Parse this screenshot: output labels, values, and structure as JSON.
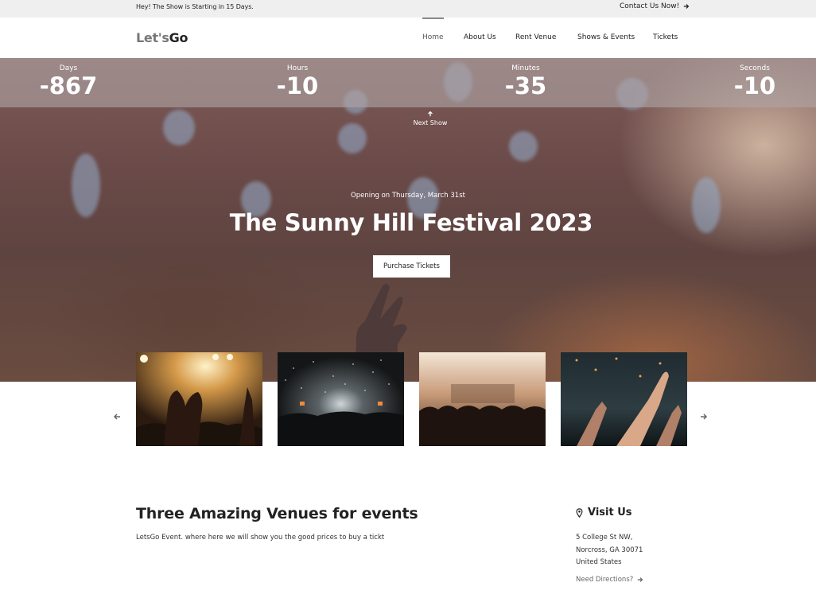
{
  "topbar": {
    "message": "Hey! The Show is Starting in 15 Days.",
    "contact_label": "Contact Us Now!"
  },
  "brand": {
    "logo_part1": "Let's",
    "logo_part2": "Go"
  },
  "nav": {
    "items": [
      {
        "label": "Home",
        "active": true
      },
      {
        "label": "About Us"
      },
      {
        "label": "Rent Venue"
      },
      {
        "label": "Shows & Events"
      },
      {
        "label": "Tickets"
      }
    ]
  },
  "countdown": {
    "days_label": "Days",
    "days_value": "-867",
    "hours_label": "Hours",
    "hours_value": "-10",
    "minutes_label": "Minutes",
    "minutes_value": "-35",
    "seconds_label": "Seconds",
    "seconds_value": "-10"
  },
  "hero": {
    "next_show_label": "Next Show",
    "opening_text": "Opening on Thursday, March 31st",
    "title": "The Sunny Hill Festival 2023",
    "purchase_button": "Purchase Tickets"
  },
  "gallery": {
    "prev_icon": "arrow-left-icon",
    "next_icon": "arrow-right-icon"
  },
  "venues": {
    "title": "Three Amazing Venues for events",
    "text": "LetsGo Event. where here we will show you the good prices to buy a tickt"
  },
  "visit": {
    "title": "Visit Us",
    "address_line1": "5 College St NW,",
    "address_line2": "Norcross, GA 30071",
    "address_line3": "United States",
    "directions_label": "Need Directions?"
  },
  "colors": {
    "topbar_bg": "#efefef",
    "hero_overlay": "#6a4a48",
    "text_dark": "#222222"
  }
}
